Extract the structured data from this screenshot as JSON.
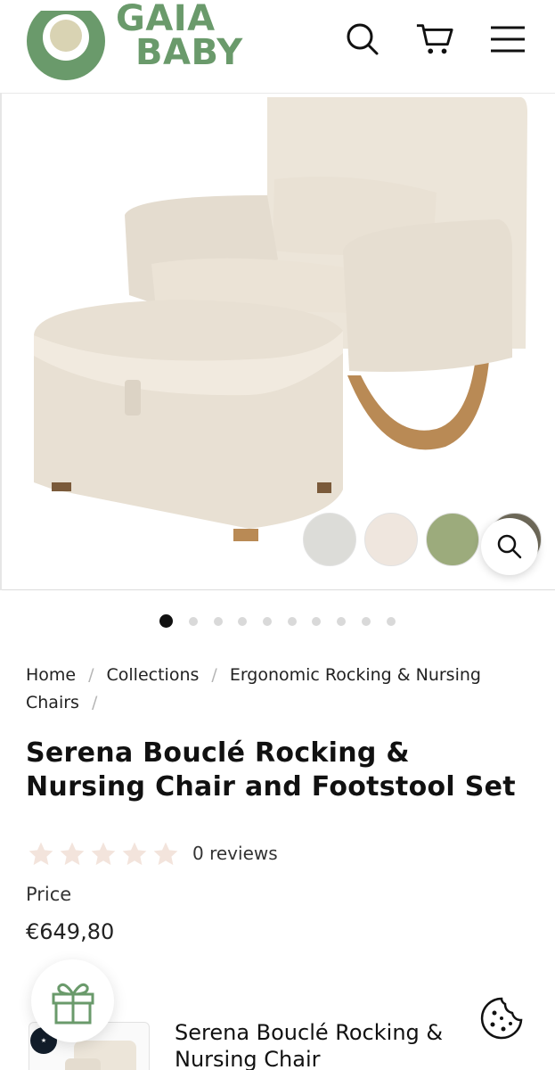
{
  "header": {
    "logo_line1": "GAIA",
    "logo_line2": "BABY",
    "icons": [
      "search-icon",
      "cart-icon",
      "menu-icon"
    ]
  },
  "gallery": {
    "swatches": [
      {
        "name": "grey",
        "color": "#dcdcd8"
      },
      {
        "name": "cream",
        "color": "#efe6de"
      },
      {
        "name": "green",
        "color": "#9cab7c"
      }
    ],
    "dots_total": 10,
    "active_dot": 1
  },
  "breadcrumb": {
    "home": "Home",
    "collections": "Collections",
    "category": "Ergonomic Rocking & Nursing Chairs",
    "separator": "/"
  },
  "product": {
    "title": "Serena Bouclé Rocking & Nursing Chair and Footstool Set",
    "rating": 0,
    "reviews_label": "0 reviews",
    "price_label": "Price",
    "price": "€649,80"
  },
  "variant": {
    "title": "Serena Bouclé Rocking & Nursing Chair"
  },
  "colors": {
    "brand_green": "#6a9a6b",
    "star_empty": "#f3e4dc"
  }
}
